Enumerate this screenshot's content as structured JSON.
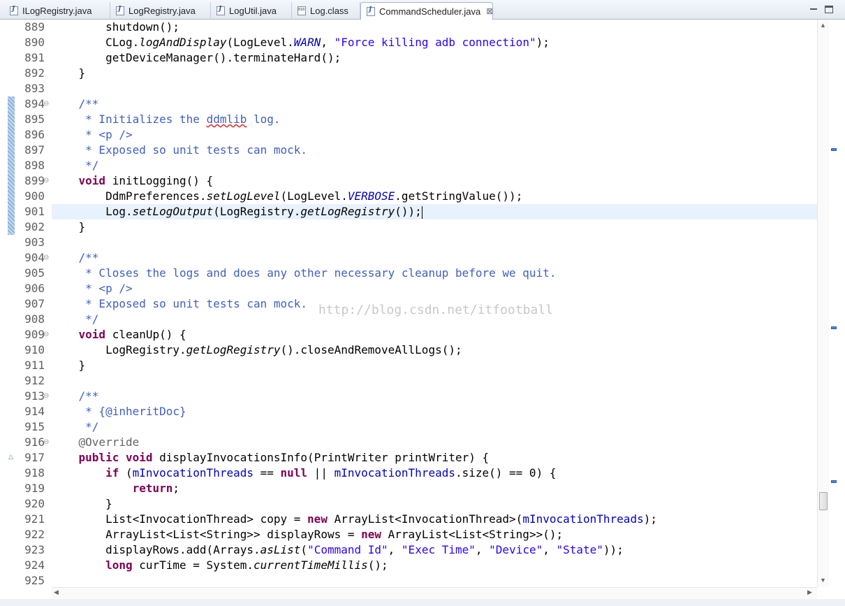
{
  "tabs": [
    {
      "label": "ILogRegistry.java",
      "icon": "java-file-icon",
      "active": false
    },
    {
      "label": "LogRegistry.java",
      "icon": "java-file-icon",
      "active": false
    },
    {
      "label": "LogUtil.java",
      "icon": "java-file-icon",
      "active": false
    },
    {
      "label": "Log.class",
      "icon": "class-file-icon",
      "active": false
    },
    {
      "label": "CommandScheduler.java",
      "icon": "java-file-icon",
      "active": true,
      "close": "⊠"
    }
  ],
  "watermark": "http://blog.csdn.net/itfootball",
  "current_line": 901,
  "colors": {
    "keyword": "#7f0055",
    "string": "#2a00ff",
    "javadoc": "#3f5fbf",
    "field": "#0000c0",
    "annotation": "#646464",
    "current_line_bg": "#e8f2fe"
  },
  "lines": [
    {
      "no": "889",
      "fold": "",
      "tokens": [
        [
          "",
          "        shutdown();"
        ]
      ]
    },
    {
      "no": "890",
      "fold": "",
      "tokens": [
        [
          "",
          "        CLog."
        ],
        [
          "i",
          "logAndDisplay"
        ],
        [
          "",
          "(LogLevel."
        ],
        [
          "cst",
          "WARN"
        ],
        [
          "",
          ", "
        ],
        [
          "s",
          "\"Force killing adb connection\""
        ],
        [
          "",
          ");"
        ]
      ]
    },
    {
      "no": "891",
      "fold": "",
      "tokens": [
        [
          "",
          "        getDeviceManager().terminateHard();"
        ]
      ]
    },
    {
      "no": "892",
      "fold": "",
      "tokens": [
        [
          "",
          "    }"
        ]
      ]
    },
    {
      "no": "893",
      "fold": "",
      "tokens": []
    },
    {
      "no": "894",
      "fold": "⊖",
      "tokens": [
        [
          "c",
          "    /**"
        ]
      ]
    },
    {
      "no": "895",
      "fold": "",
      "tokens": [
        [
          "c",
          "     * Initializes the "
        ],
        [
          "c sq",
          "ddmlib"
        ],
        [
          "c",
          " log."
        ]
      ]
    },
    {
      "no": "896",
      "fold": "",
      "tokens": [
        [
          "c",
          "     * <p />"
        ]
      ]
    },
    {
      "no": "897",
      "fold": "",
      "tokens": [
        [
          "c",
          "     * Exposed so unit tests can mock."
        ]
      ]
    },
    {
      "no": "898",
      "fold": "",
      "tokens": [
        [
          "c",
          "     */"
        ]
      ]
    },
    {
      "no": "899",
      "fold": "⊖",
      "tokens": [
        [
          "k",
          "    void"
        ],
        [
          "",
          " initLogging() {"
        ]
      ]
    },
    {
      "no": "900",
      "fold": "",
      "tokens": [
        [
          "",
          "        DdmPreferences."
        ],
        [
          "i",
          "setLogLevel"
        ],
        [
          "",
          "(LogLevel."
        ],
        [
          "cst",
          "VERBOSE"
        ],
        [
          "",
          ".getStringValue());"
        ]
      ]
    },
    {
      "no": "901",
      "fold": "",
      "tokens": [
        [
          "",
          "        Log."
        ],
        [
          "i",
          "setLogOutput"
        ],
        [
          "",
          "(LogRegistry."
        ],
        [
          "i",
          "getLogRegistry"
        ],
        [
          "",
          "());"
        ]
      ]
    },
    {
      "no": "902",
      "fold": "",
      "tokens": [
        [
          "",
          "    }"
        ]
      ]
    },
    {
      "no": "903",
      "fold": "",
      "tokens": []
    },
    {
      "no": "904",
      "fold": "⊖",
      "tokens": [
        [
          "c",
          "    /**"
        ]
      ]
    },
    {
      "no": "905",
      "fold": "",
      "tokens": [
        [
          "c",
          "     * Closes the logs and does any other necessary cleanup before we quit."
        ]
      ]
    },
    {
      "no": "906",
      "fold": "",
      "tokens": [
        [
          "c",
          "     * <p />"
        ]
      ]
    },
    {
      "no": "907",
      "fold": "",
      "tokens": [
        [
          "c",
          "     * Exposed so unit tests can mock."
        ]
      ]
    },
    {
      "no": "908",
      "fold": "",
      "tokens": [
        [
          "c",
          "     */"
        ]
      ]
    },
    {
      "no": "909",
      "fold": "⊖",
      "tokens": [
        [
          "k",
          "    void"
        ],
        [
          "",
          " cleanUp() {"
        ]
      ]
    },
    {
      "no": "910",
      "fold": "",
      "tokens": [
        [
          "",
          "        LogRegistry."
        ],
        [
          "i",
          "getLogRegistry"
        ],
        [
          "",
          "().closeAndRemoveAllLogs();"
        ]
      ]
    },
    {
      "no": "911",
      "fold": "",
      "tokens": [
        [
          "",
          "    }"
        ]
      ]
    },
    {
      "no": "912",
      "fold": "",
      "tokens": []
    },
    {
      "no": "913",
      "fold": "⊖",
      "tokens": [
        [
          "c",
          "    /**"
        ]
      ]
    },
    {
      "no": "914",
      "fold": "",
      "tokens": [
        [
          "c",
          "     * {@inheritDoc}"
        ]
      ]
    },
    {
      "no": "915",
      "fold": "",
      "tokens": [
        [
          "c",
          "     */"
        ]
      ]
    },
    {
      "no": "916",
      "fold": "⊖",
      "tokens": [
        [
          "a",
          "    @Override"
        ]
      ]
    },
    {
      "no": "917",
      "fold": "",
      "tokens": [
        [
          "k",
          "    public void"
        ],
        [
          "",
          " displayInvocationsInfo(PrintWriter printWriter) {"
        ]
      ]
    },
    {
      "no": "918",
      "fold": "",
      "tokens": [
        [
          "k",
          "        if"
        ],
        [
          "",
          " ("
        ],
        [
          "f",
          "mInvocationThreads"
        ],
        [
          "",
          " == "
        ],
        [
          "k",
          "null"
        ],
        [
          "",
          " || "
        ],
        [
          "f",
          "mInvocationThreads"
        ],
        [
          "",
          ".size() == 0) {"
        ]
      ]
    },
    {
      "no": "919",
      "fold": "",
      "tokens": [
        [
          "k",
          "            return"
        ],
        [
          "",
          ";"
        ]
      ]
    },
    {
      "no": "920",
      "fold": "",
      "tokens": [
        [
          "",
          "        }"
        ]
      ]
    },
    {
      "no": "921",
      "fold": "",
      "tokens": [
        [
          "",
          "        List<InvocationThread> copy = "
        ],
        [
          "k",
          "new"
        ],
        [
          "",
          " ArrayList<InvocationThread>("
        ],
        [
          "f",
          "mInvocationThreads"
        ],
        [
          "",
          ");"
        ]
      ]
    },
    {
      "no": "922",
      "fold": "",
      "tokens": [
        [
          "",
          "        ArrayList<List<String>> displayRows = "
        ],
        [
          "k",
          "new"
        ],
        [
          "",
          " ArrayList<List<String>>();"
        ]
      ]
    },
    {
      "no": "923",
      "fold": "",
      "tokens": [
        [
          "",
          "        displayRows.add(Arrays."
        ],
        [
          "i",
          "asList"
        ],
        [
          "",
          "("
        ],
        [
          "s",
          "\"Command Id\""
        ],
        [
          "",
          ", "
        ],
        [
          "s",
          "\"Exec Time\""
        ],
        [
          "",
          ", "
        ],
        [
          "s",
          "\"Device\""
        ],
        [
          "",
          ", "
        ],
        [
          "s",
          "\"State\""
        ],
        [
          "",
          "));"
        ]
      ]
    },
    {
      "no": "924",
      "fold": "",
      "tokens": [
        [
          "k",
          "        long"
        ],
        [
          "",
          " curTime = System."
        ],
        [
          "i",
          "currentTimeMillis"
        ],
        [
          "",
          "();"
        ]
      ]
    },
    {
      "no": "925",
      "fold": "",
      "tokens": []
    }
  ]
}
